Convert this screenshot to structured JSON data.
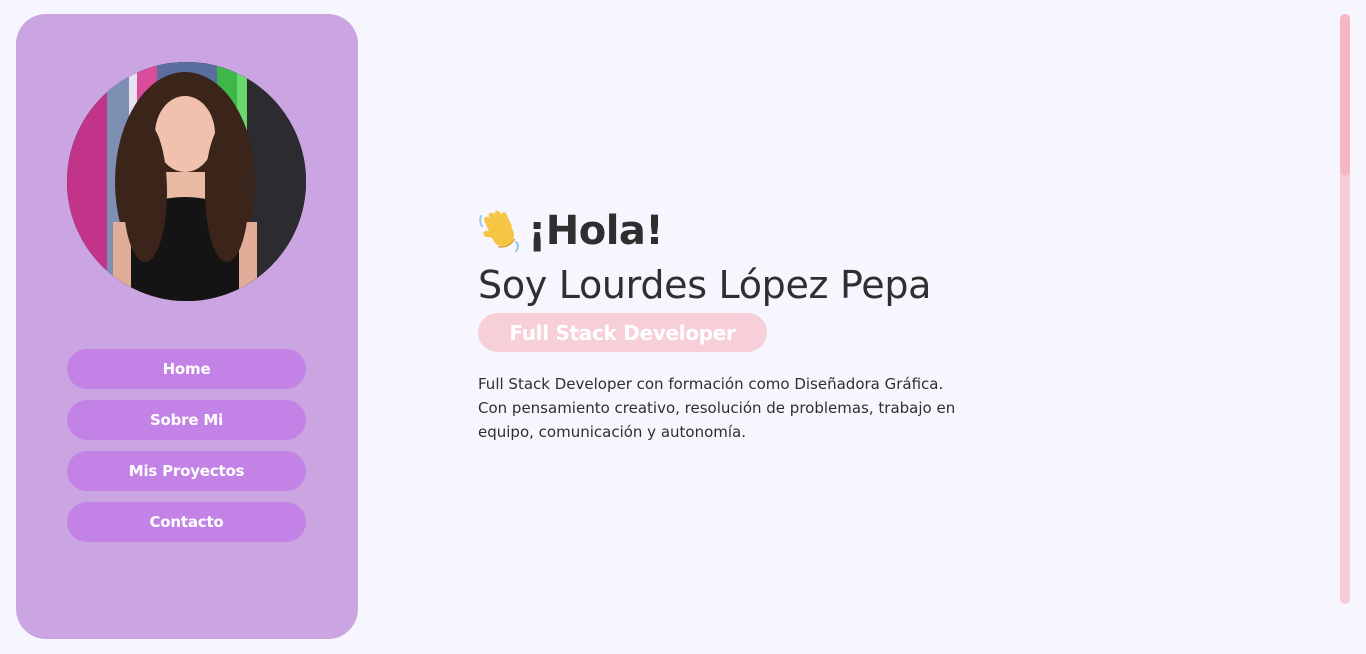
{
  "sidebar": {
    "avatar_alt": "Profile photo",
    "nav": [
      {
        "label": "Home"
      },
      {
        "label": "Sobre Mi"
      },
      {
        "label": "Mis Proyectos"
      },
      {
        "label": "Contacto"
      }
    ]
  },
  "hero": {
    "wave_icon": "waving-hand-icon",
    "greeting": "¡Hola!",
    "name": "Soy Lourdes López Pepa",
    "role": "Full Stack Developer",
    "bio": "Full Stack Developer con formación como Diseñadora Gráfica. Con pensamiento creativo, resolución de problemas, trabajo en equipo, comunicación y autonomía."
  },
  "colors": {
    "background": "#f7f6fe",
    "sidebar": "#caa5e2",
    "nav_button": "#c383e6",
    "badge": "#f7cfd8",
    "scrollbar_track": "#f8cdd6",
    "scrollbar_thumb": "#f6b7c4",
    "text": "#2f2f2f"
  },
  "scroll": {
    "position_fraction": 0.0
  }
}
